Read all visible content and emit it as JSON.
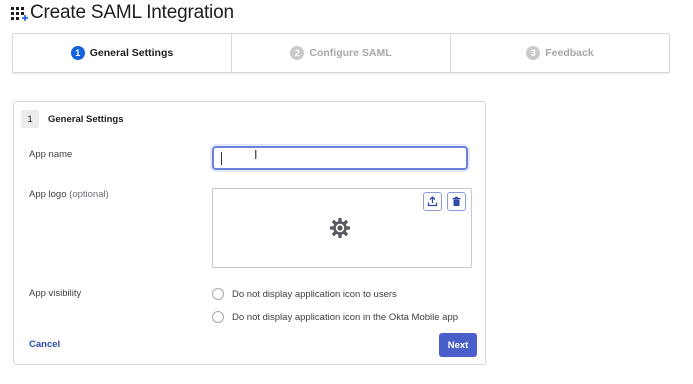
{
  "page": {
    "title": "Create SAML Integration"
  },
  "stepper": {
    "steps": [
      {
        "number": "1",
        "label": "General Settings"
      },
      {
        "number": "2",
        "label": "Configure SAML"
      },
      {
        "number": "3",
        "label": "Feedback"
      }
    ]
  },
  "card": {
    "number": "1",
    "title": "General Settings",
    "app_name_label": "App name",
    "app_name_value": "",
    "app_logo_label": "App logo",
    "app_logo_optional": "(optional)",
    "app_visibility_label": "App visibility",
    "visibility_options": [
      "Do not display application icon to users",
      "Do not display application icon in the Okta Mobile app"
    ],
    "cancel_label": "Cancel",
    "next_label": "Next"
  },
  "colors": {
    "accent": "#1662dd",
    "primary_button": "#4a5fc9",
    "link": "#2c4aa8",
    "focus_border": "#6d82e0"
  }
}
